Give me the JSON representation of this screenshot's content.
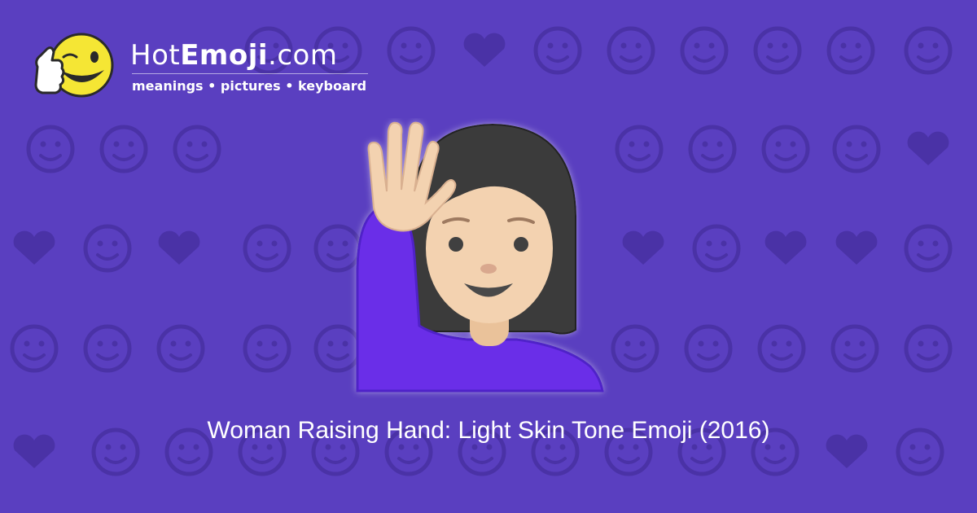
{
  "site": {
    "name_light": "Hot",
    "name_bold": "Emoji",
    "name_tld": ".com",
    "tagline": "meanings • pictures • keyboard"
  },
  "hero": {
    "emoji_icon": "woman-raising-hand-light-skin-tone-icon"
  },
  "caption": {
    "text": "Woman Raising Hand: Light Skin Tone Emoji (2016)"
  },
  "colors": {
    "background": "#5a3fc0",
    "pattern": "#4c33a8",
    "text": "#ffffff",
    "shirt": "#6a2ee8",
    "skin": "#f3d2b0",
    "hair": "#3a3a3a"
  }
}
